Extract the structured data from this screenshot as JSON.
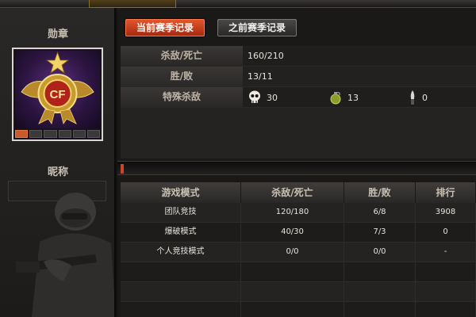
{
  "left_panel": {
    "medal_label": "勋章",
    "nickname_label": "昵称",
    "medal_emblem": "CF"
  },
  "buttons": {
    "current_season": "当前赛季记录",
    "previous_season": "之前赛季记录"
  },
  "summary": {
    "kill_death_label": "杀敌/死亡",
    "kill_death_value": "160/210",
    "win_loss_label": "胜/败",
    "win_loss_value": "13/11",
    "special_kills_label": "特殊杀敌",
    "special_kills": [
      {
        "icon": "skull-icon",
        "value": "30"
      },
      {
        "icon": "grenade-icon",
        "value": "13"
      },
      {
        "icon": "knife-icon",
        "value": "0"
      }
    ]
  },
  "mode_table": {
    "headers": [
      "游戏模式",
      "杀敌/死亡",
      "胜/败",
      "排行"
    ],
    "rows": [
      [
        "团队竞技",
        "120/180",
        "6/8",
        "3908"
      ],
      [
        "爆破模式",
        "40/30",
        "7/3",
        "0"
      ],
      [
        "个人竞技模式",
        "0/0",
        "0/0",
        "-"
      ],
      [
        "",
        "",
        "",
        ""
      ],
      [
        "",
        "",
        "",
        ""
      ],
      [
        "",
        "",
        "",
        ""
      ]
    ]
  },
  "colors": {
    "accent_orange": "#e2552c",
    "gold": "#e6c16a"
  }
}
